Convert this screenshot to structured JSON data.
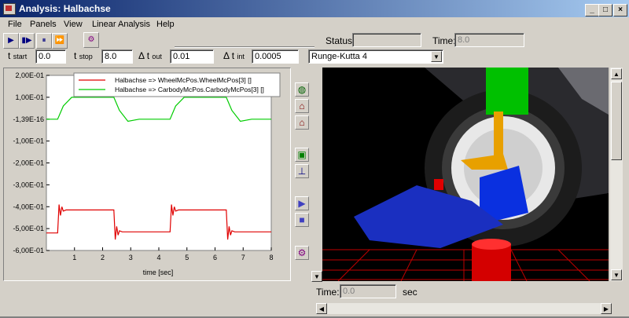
{
  "window": {
    "title": "Analysis: Halbachse",
    "controls": {
      "minimize": "_",
      "maximize": "□",
      "close": "×"
    }
  },
  "menu": [
    "File",
    "Panels",
    "View",
    "Linear Analysis",
    "Help"
  ],
  "toolbar": {
    "buttons": [
      {
        "icon": "play-icon",
        "glyph": "▶"
      },
      {
        "icon": "step-icon",
        "glyph": "▮▶"
      },
      {
        "icon": "pause-icon",
        "glyph": "⏸"
      },
      {
        "icon": "fast-forward-icon",
        "glyph": "⏩"
      },
      {
        "icon": "settings-icon",
        "glyph": "⚙"
      }
    ],
    "status_label": "Status:",
    "status_value": "",
    "time_label": "Time:",
    "time_value": "8.0"
  },
  "params": {
    "t_start_label": "t",
    "t_start_sub": "start",
    "t_start": "0.0",
    "t_stop_label": "t",
    "t_stop_sub": "stop",
    "t_stop": "8.0",
    "dt_out_label": "Δ t",
    "dt_out_sub": "out",
    "dt_out": "0.01",
    "dt_int_label": "Δ t",
    "dt_int_sub": "int",
    "dt_int": "0.0005",
    "integrator": "Runge-Kutta 4"
  },
  "plot": {
    "legend": [
      {
        "name": "Halbachse => WheelMcPos.WheelMcPos[3] []",
        "color": "#e00000"
      },
      {
        "name": "Halbachse => CarbodyMcPos.CarbodyMcPos[3] []",
        "color": "#00cc00"
      }
    ],
    "xlabel": "time [sec]"
  },
  "chart_data": {
    "type": "line",
    "xlabel": "time [sec]",
    "xlim": [
      0,
      8
    ],
    "ylim": [
      -0.6,
      0.2
    ],
    "x_ticks": [
      "1",
      "2",
      "3",
      "4",
      "5",
      "6",
      "7",
      "8"
    ],
    "y_ticks": [
      "2,00E-01",
      "1,00E-01",
      "-1,39E-16",
      "-1,00E-01",
      "-2,00E-01",
      "-3,00E-01",
      "-4,00E-01",
      "-5,00E-01",
      "-6,00E-01"
    ],
    "y_tick_values": [
      0.2,
      0.1,
      0,
      -0.1,
      -0.2,
      -0.3,
      -0.4,
      -0.5,
      -0.6
    ],
    "series": [
      {
        "name": "Halbachse => WheelMcPos.WheelMcPos[3] []",
        "color": "#e00000",
        "x": [
          0,
          0.4,
          0.45,
          0.5,
          0.55,
          0.6,
          0.7,
          2.4,
          2.45,
          2.5,
          2.55,
          2.6,
          2.7,
          4.4,
          4.45,
          4.5,
          4.55,
          4.6,
          4.7,
          6.4,
          6.45,
          6.5,
          6.55,
          6.6,
          6.7,
          8
        ],
        "y": [
          -0.52,
          -0.52,
          -0.39,
          -0.44,
          -0.4,
          -0.42,
          -0.415,
          -0.415,
          -0.55,
          -0.49,
          -0.53,
          -0.51,
          -0.515,
          -0.515,
          -0.39,
          -0.44,
          -0.4,
          -0.42,
          -0.415,
          -0.415,
          -0.55,
          -0.49,
          -0.53,
          -0.51,
          -0.515,
          -0.515
        ]
      },
      {
        "name": "Halbachse => CarbodyMcPos.CarbodyMcPos[3] []",
        "color": "#00cc00",
        "x": [
          0,
          0.4,
          0.6,
          0.9,
          2.4,
          2.6,
          2.9,
          3.3,
          4.4,
          4.6,
          4.9,
          6.4,
          6.6,
          6.9,
          7.3,
          8
        ],
        "y": [
          0,
          0,
          0.06,
          0.1,
          0.1,
          0.04,
          -0.01,
          0,
          0,
          0.06,
          0.1,
          0.1,
          0.04,
          -0.01,
          0,
          0
        ]
      }
    ]
  },
  "side_tools": [
    "globe-icon",
    "home-icon",
    "home-alt-icon",
    "cube-icon",
    "axes-icon",
    "play-icon",
    "stop-icon",
    "settings-icon"
  ],
  "view3d": {
    "time_label": "Time:",
    "time_value": "0.0",
    "time_unit": "sec"
  }
}
